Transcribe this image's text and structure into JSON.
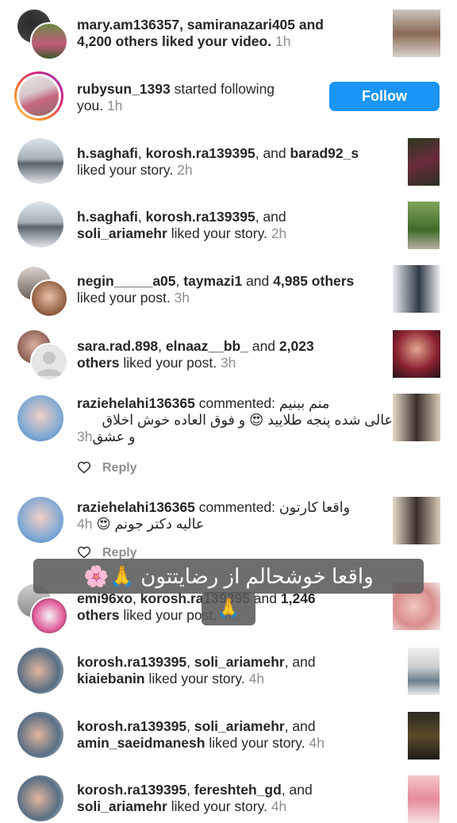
{
  "notifications": [
    {
      "users": "mary.am136357, samiranazari405 and",
      "rest": "4,200 others liked your video.",
      "time": "1h"
    },
    {
      "user": "rubysun_1393",
      "action": "started following",
      "action2": "you.",
      "time": "1h",
      "button": "Follow"
    },
    {
      "u1": "h.saghafi",
      "u2": "korosh.ra139395",
      "u3": "barad92_s",
      "rest": "liked your story.",
      "time": "2h"
    },
    {
      "u1": "h.saghafi",
      "u2": "korosh.ra139395",
      "u3": "soli_ariamehr",
      "rest": "liked your story.",
      "time": "2h"
    },
    {
      "u1": "negin_____a05",
      "u2": "taymazi1",
      "u3": "4,985 others",
      "rest": "liked your post.",
      "time": "3h"
    },
    {
      "u1": "sara.rad.898",
      "u2": "elnaaz__bb_",
      "u3": "2,023",
      "u3b": "others",
      "rest": "liked your post.",
      "time": "3h"
    },
    {
      "user": "raziehelahi136365",
      "action": "commented:",
      "c1": "منم ببنیم",
      "c2": "عالی شده پنجه طلایید 😍 و فوق العاده خوش اخلاق",
      "c3": "و عشق",
      "time": "3h",
      "reply": "Reply"
    },
    {
      "user": "raziehelahi136365",
      "action": "commented:",
      "c1": "واقعا کارتون",
      "c2": "عالیه دکتر جونم 😍",
      "time": "4h",
      "reply": "Reply"
    },
    {
      "u1": "emi96xo",
      "u2": "korosh.ra139395",
      "u3": "1,246",
      "u3b": "others",
      "rest": "liked your post.",
      "time": "4h"
    },
    {
      "u1": "korosh.ra139395",
      "u2": "soli_ariamehr",
      "u3": "kiaiebanin",
      "rest": "liked your story.",
      "time": "4h"
    },
    {
      "u1": "korosh.ra139395",
      "u2": "soli_ariamehr",
      "u3": "amin_saeidmanesh",
      "rest": "liked your story.",
      "time": "4h"
    },
    {
      "u1": "korosh.ra139395",
      "u2": "fereshteh_gd",
      "u3": "soli_ariamehr",
      "rest": "liked your story.",
      "time": "4h"
    }
  ],
  "overlay": {
    "caption": "واقعا خوشحالم از رضایتتون 🙏🌸",
    "emoji": "🙏"
  },
  "colors": {
    "accent": "#1a95f5",
    "muted": "#8e8e8e",
    "text": "#262626"
  }
}
